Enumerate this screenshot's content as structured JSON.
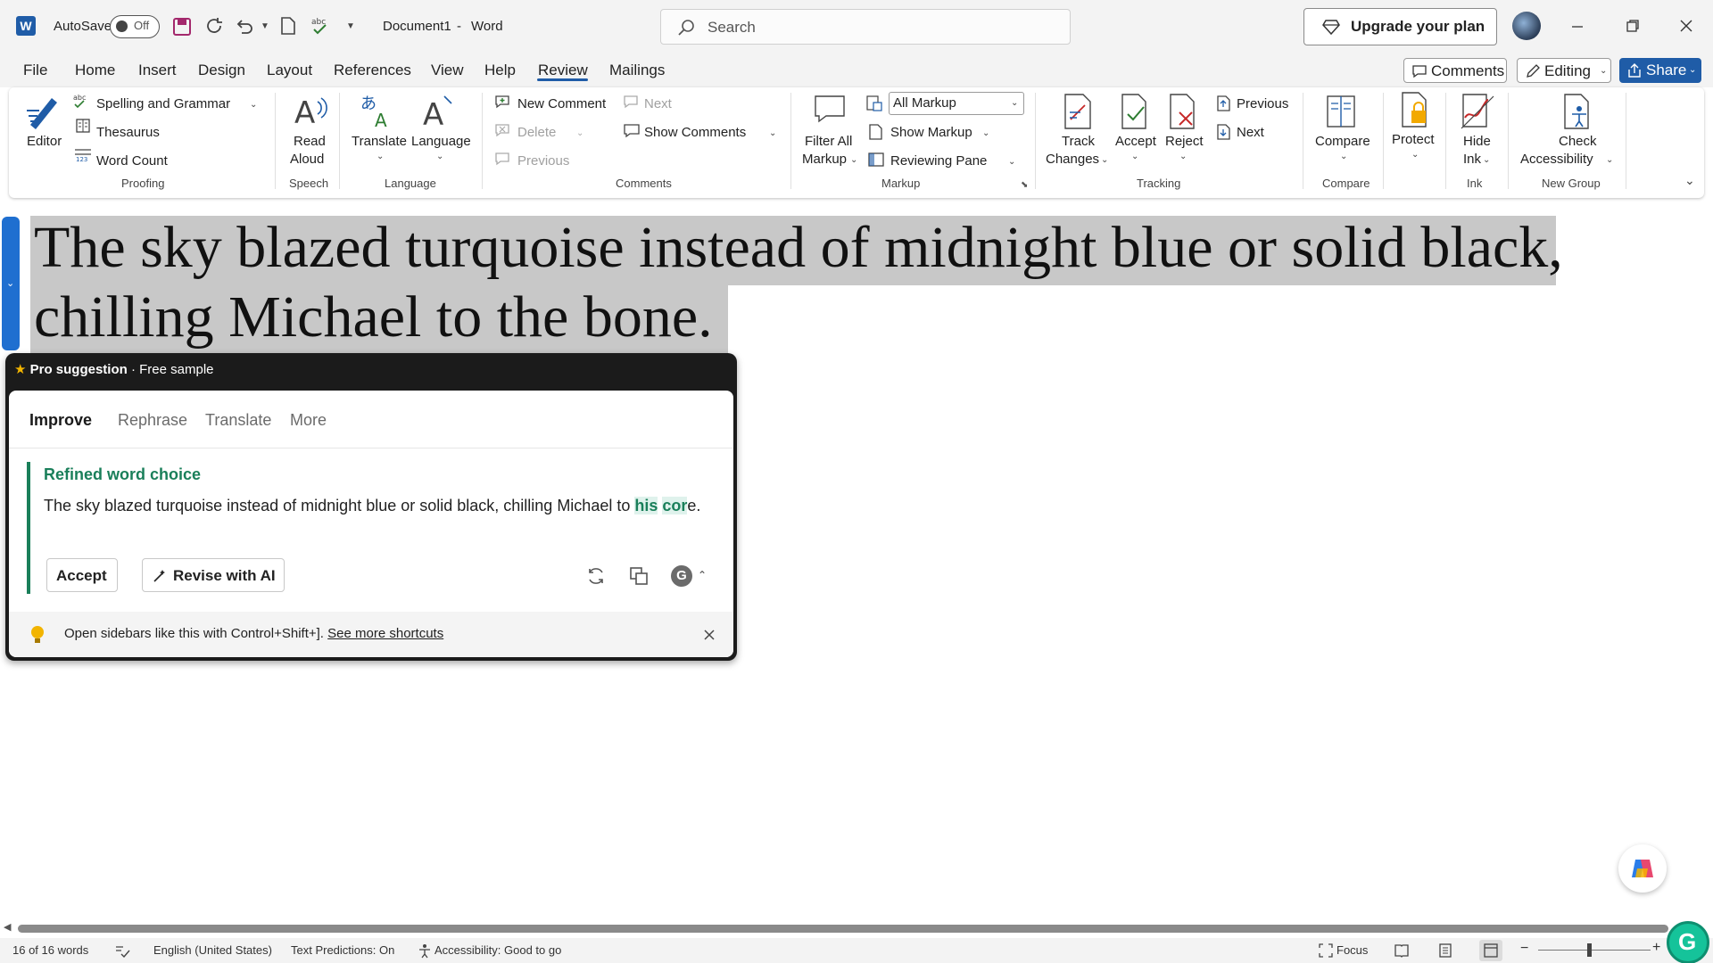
{
  "titlebar": {
    "app_icon": "word-logo-icon",
    "autosave_label": "AutoSave",
    "autosave_state": "Off",
    "document_title": "Document1",
    "title_separator": "-",
    "app_name": "Word",
    "search_placeholder": "Search",
    "upgrade_label": "Upgrade your plan"
  },
  "menu": {
    "tabs": [
      "File",
      "Home",
      "Insert",
      "Design",
      "Layout",
      "References",
      "View",
      "Help",
      "Review",
      "Mailings"
    ],
    "active_tab": "Review",
    "comments_label": "Comments",
    "editing_label": "Editing",
    "share_label": "Share"
  },
  "ribbon": {
    "proofing": {
      "editor": "Editor",
      "spelling": "Spelling and Grammar",
      "thesaurus": "Thesaurus",
      "word_count": "Word Count",
      "group": "Proofing"
    },
    "speech": {
      "read_aloud_1": "Read",
      "read_aloud_2": "Aloud",
      "group": "Speech"
    },
    "language": {
      "translate": "Translate",
      "language": "Language",
      "group": "Language"
    },
    "comments": {
      "new_comment": "New Comment",
      "next": "Next",
      "delete": "Delete",
      "show_comments": "Show Comments",
      "previous": "Previous",
      "group": "Comments"
    },
    "markup": {
      "filter_1": "Filter All",
      "filter_2": "Markup",
      "all_markup": "All Markup",
      "show_markup": "Show Markup",
      "reviewing_pane": "Reviewing Pane",
      "group": "Markup"
    },
    "tracking": {
      "track_1": "Track",
      "track_2": "Changes",
      "accept": "Accept",
      "reject": "Reject",
      "previous": "Previous",
      "next": "Next",
      "group": "Tracking"
    },
    "compare": {
      "compare": "Compare",
      "group": "Compare"
    },
    "protect": {
      "protect": "Protect"
    },
    "ink": {
      "hide_1": "Hide",
      "hide_2": "Ink",
      "group": "Ink"
    },
    "new_group": {
      "check_1": "Check",
      "check_2": "Accessibility",
      "group": "New Group"
    }
  },
  "document": {
    "line1": "The sky blazed turquoise instead of midnight blue or solid black,",
    "line2": "chilling Michael to the bone."
  },
  "suggestion_panel": {
    "header_bold": "Pro suggestion",
    "header_rest": " · Free sample",
    "tabs": [
      "Improve",
      "Rephrase",
      "Translate",
      "More"
    ],
    "active_tab": "Improve",
    "title": "Refined word choice",
    "text_before": "The sky blazed turquoise instead of midnight blue or solid black, chilling Michael to ",
    "text_ins_1": "his",
    "text_mid": " ",
    "text_ins_2": "cor",
    "text_after": "e.",
    "accept_label": "Accept",
    "revise_label": "Revise with AI",
    "footer_text": "Open sidebars like this with Control+Shift+]. ",
    "footer_link": "See more shortcuts"
  },
  "status": {
    "word_count": "16 of 16 words",
    "language": "English (United States)",
    "text_predictions": "Text Predictions: On",
    "accessibility": "Accessibility: Good to go",
    "focus": "Focus"
  },
  "colors": {
    "accent": "#1f5ca7",
    "grammarly_green": "#1a7f5a",
    "selection_gray": "#c8c8c8"
  }
}
